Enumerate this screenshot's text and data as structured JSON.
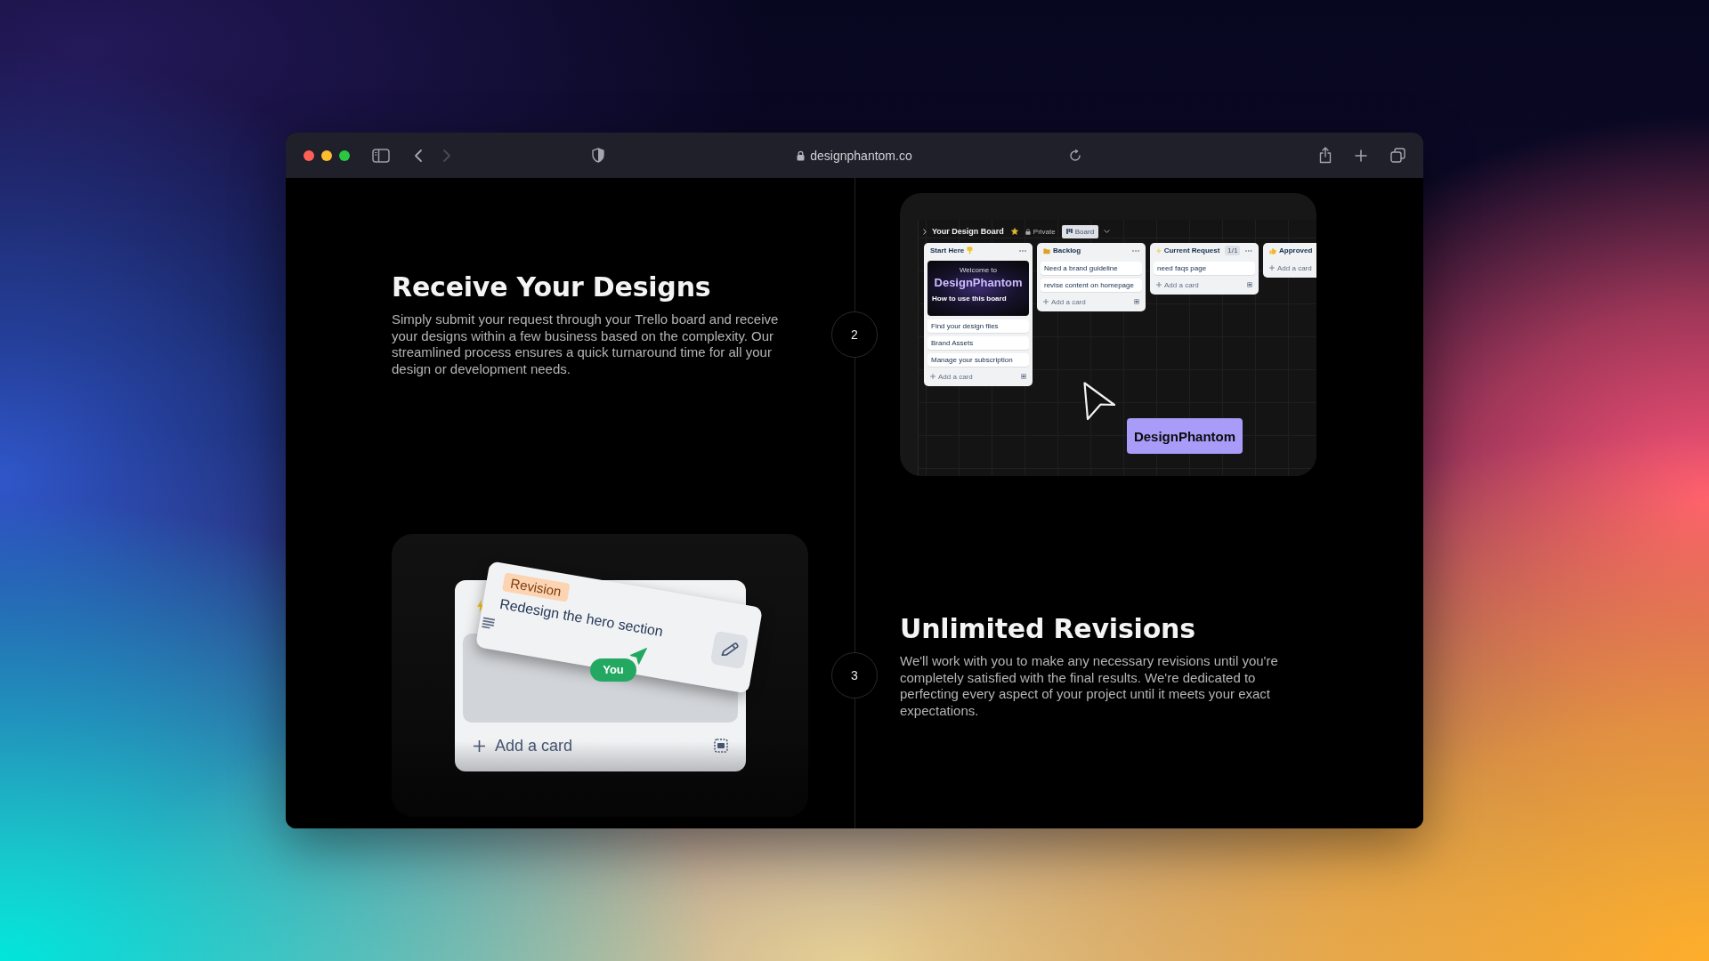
{
  "browser": {
    "url": "designphantom.co",
    "back_disabled": false,
    "forward_disabled": true
  },
  "steps": [
    {
      "number": "2",
      "title": "Receive Your Designs",
      "body": "Simply submit your request through your Trello board and receive your designs within a few business based on the complexity. Our streamlined process ensures a quick turnaround time for all your design or development needs."
    },
    {
      "number": "3",
      "title": "Unlimited Revisions",
      "body": "We'll work with you to make any necessary revisions until you're completely satisfied with the final results. We're dedicated to perfecting every aspect of your project until it meets your exact expectations."
    }
  ],
  "board_preview": {
    "board_title": "Your Design Board",
    "starred": true,
    "visibility": "Private",
    "view": "Board",
    "lists": [
      {
        "title": "Start Here",
        "cover": {
          "welcome": "Welcome to",
          "brand": "DesignPhantom",
          "caption": "How to use this board"
        },
        "cards": [
          "Find your design files",
          "Brand Assets",
          "Manage your subscription"
        ],
        "add_label": "Add a card"
      },
      {
        "title": "Backlog",
        "cards": [
          "Need a brand guideline",
          "revise content on homepage"
        ],
        "add_label": "Add a card"
      },
      {
        "title": "Current Request",
        "count": "1/1",
        "cards": [
          "need faqs page"
        ],
        "add_label": "Add a card"
      },
      {
        "title": "Approved",
        "add_label": "Add a card"
      }
    ],
    "badge": "DesignPhantom"
  },
  "revision_preview": {
    "label": "Revision",
    "card_title": "Redesign the hero section",
    "assignee": "You",
    "add_label": "Add a card"
  }
}
